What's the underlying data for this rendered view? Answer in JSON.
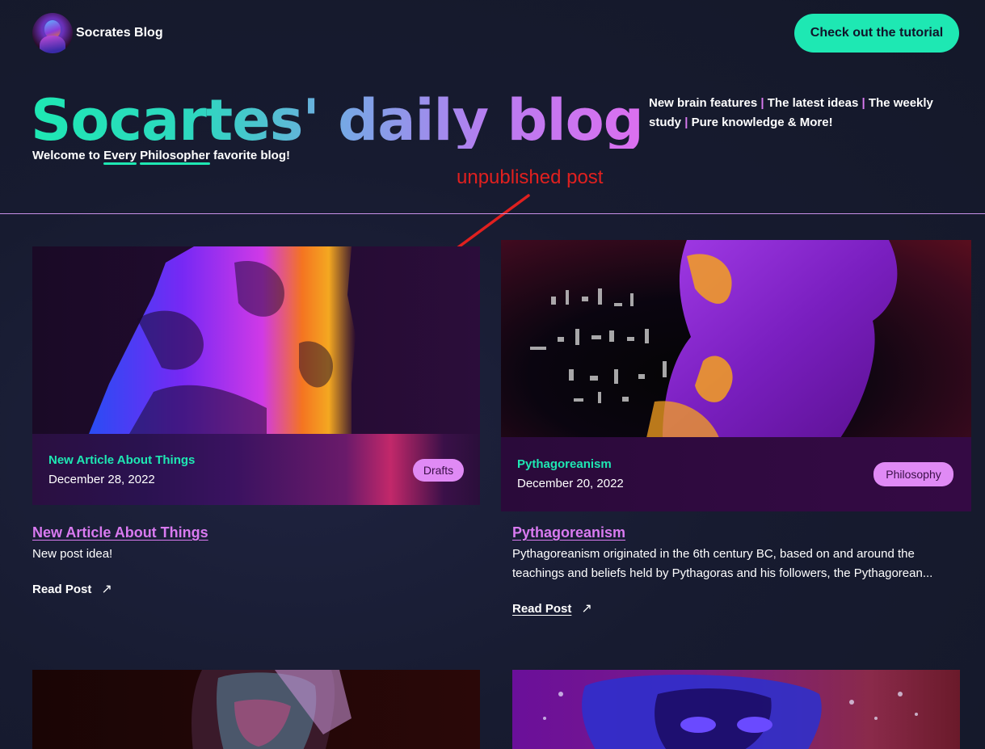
{
  "header": {
    "brand_name": "Socrates Blog",
    "cta_label": "Check out the tutorial"
  },
  "hero": {
    "title": "Socartes' daily blog",
    "subtitle_prefix": "Welcome to ",
    "subtitle_words": [
      "Every",
      "Philosopher"
    ],
    "subtitle_suffix": " favorite blog!",
    "tagline": [
      "New brain features",
      "The latest ideas",
      "The weekly study",
      "Pure knowledge & More!"
    ],
    "tagline_separator": "|"
  },
  "annotation": {
    "text": "unpublished post",
    "color": "#e0201f"
  },
  "posts": [
    {
      "overlay_title": "New Article About Things",
      "date": "December 28, 2022",
      "category": "Drafts",
      "title": "New Article About Things",
      "excerpt": "New post idea!",
      "read_label": "Read Post",
      "read_icon": "arrow-up-right-icon"
    },
    {
      "overlay_title": "Pythagoreanism",
      "date": "December 20, 2022",
      "category": "Philosophy",
      "title": "Pythagoreanism",
      "excerpt_lines": [
        "Pythagoreanism originated in the 6th century BC, based on and around the",
        "teachings and beliefs held by Pythagoras and his followers, the Pythagorean..."
      ],
      "read_label": "Read Post",
      "read_icon": "arrow-up-right-icon"
    }
  ],
  "colors": {
    "accent": "#1ee8b3",
    "link": "#d97af0",
    "badge": "#e08af5",
    "background": "#171b30"
  }
}
